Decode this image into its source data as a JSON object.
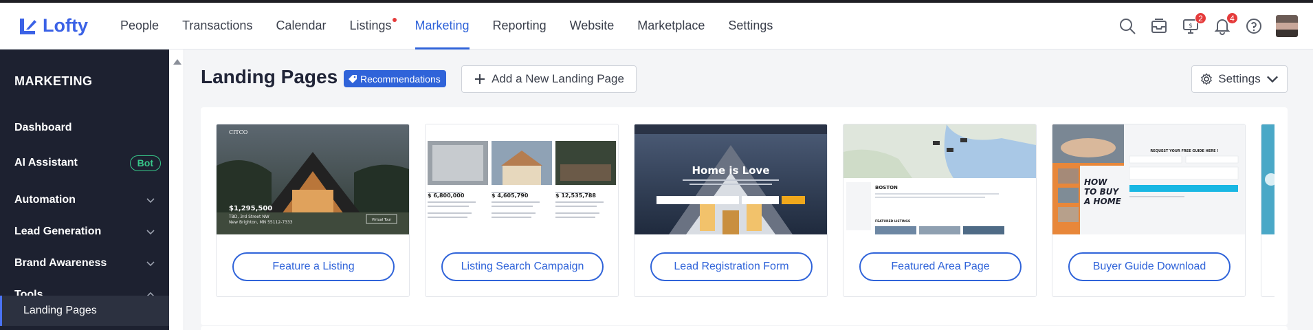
{
  "app": {
    "logo_text": "Lofty"
  },
  "nav": {
    "items": [
      {
        "label": "People"
      },
      {
        "label": "Transactions"
      },
      {
        "label": "Calendar"
      },
      {
        "label": "Listings"
      },
      {
        "label": "Marketing"
      },
      {
        "label": "Reporting"
      },
      {
        "label": "Website"
      },
      {
        "label": "Marketplace"
      },
      {
        "label": "Settings"
      }
    ],
    "active": "Marketing"
  },
  "top_icons": {
    "inbox_badge": "2",
    "notification_badge": "4"
  },
  "sidebar": {
    "title": "MARKETING",
    "items": [
      {
        "label": "Dashboard"
      },
      {
        "label": "AI Assistant",
        "badge": "Bot"
      },
      {
        "label": "Automation"
      },
      {
        "label": "Lead Generation"
      },
      {
        "label": "Brand Awareness"
      },
      {
        "label": "Tools"
      }
    ],
    "active_sub": "Landing Pages"
  },
  "main": {
    "title": "Landing Pages",
    "recommendations_label": "Recommendations",
    "add_button_label": "Add a New Landing Page",
    "settings_label": "Settings"
  },
  "cards": [
    {
      "label": "Feature a Listing",
      "thumb": {
        "brand": "CITCO",
        "price": "$1,295,500",
        "address1": "TBD, 3rd Street NW",
        "address2": "New Brighton, MN 55112-7333",
        "cta": "Virtual Tour"
      }
    },
    {
      "label": "Listing Search Campaign",
      "thumb": {
        "prices": [
          "$ 6,800,000",
          "$ 4,605,790",
          "$ 12,535,788"
        ]
      }
    },
    {
      "label": "Lead Registration Form",
      "thumb": {
        "headline": "Home is Love"
      }
    },
    {
      "label": "Featured Area Page",
      "thumb": {
        "city": "BOSTON",
        "section": "FEATURED LISTINGS"
      }
    },
    {
      "label": "Buyer Guide Download",
      "thumb": {
        "title_line1": "HOW",
        "title_line2": "TO BUY",
        "title_line3": "A HOME",
        "form_title": "REQUEST YOUR FREE GUIDE HERE !"
      }
    }
  ],
  "colors": {
    "accent": "#2f63d9",
    "sidebar_bg": "#1d2130",
    "badge_red": "#e53b3b",
    "bot_green": "#38c98b"
  }
}
